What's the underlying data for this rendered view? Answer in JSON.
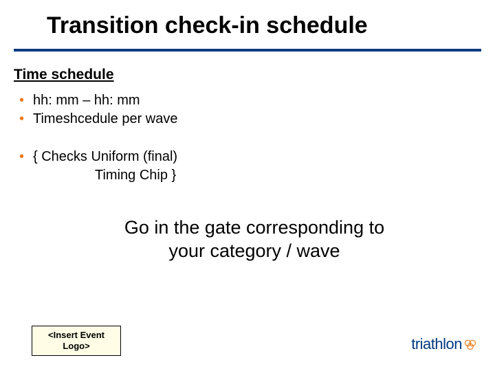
{
  "title": "Transition check-in schedule",
  "subhead": "Time schedule",
  "bullets": {
    "b1": "hh: mm – hh: mm",
    "b2": "Timeshcedule per wave",
    "b3": "{ Checks  Uniform (final)",
    "b3sub": "Timing Chip }"
  },
  "callout_line1": "Go in the gate corresponding to",
  "callout_line2": "your category / wave",
  "logo_placeholder": "<Insert Event Logo>",
  "brand": "triathlon"
}
